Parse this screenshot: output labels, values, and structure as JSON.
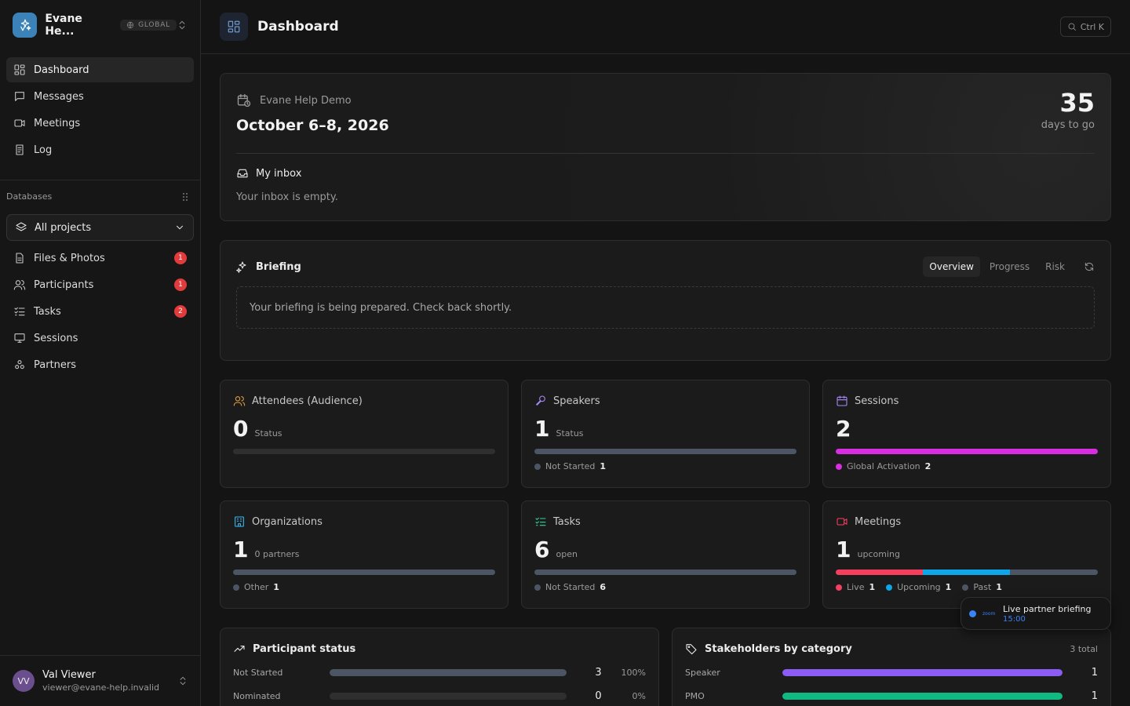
{
  "workspace": {
    "name": "Evane He...",
    "badge": "GLOBAL"
  },
  "nav": [
    {
      "label": "Dashboard",
      "icon": "dashboard-icon",
      "active": true
    },
    {
      "label": "Messages",
      "icon": "message-icon"
    },
    {
      "label": "Meetings",
      "icon": "video-icon"
    },
    {
      "label": "Log",
      "icon": "log-icon"
    }
  ],
  "databases": {
    "heading": "Databases",
    "selector": "All projects",
    "items": [
      {
        "label": "Files & Photos",
        "icon": "file-icon",
        "badge": "1"
      },
      {
        "label": "Participants",
        "icon": "users-icon",
        "badge": "1"
      },
      {
        "label": "Tasks",
        "icon": "list-checks-icon",
        "badge": "2"
      },
      {
        "label": "Sessions",
        "icon": "monitor-icon",
        "badge": ""
      },
      {
        "label": "Partners",
        "icon": "partners-icon",
        "badge": ""
      }
    ]
  },
  "user": {
    "initials": "VV",
    "name": "Val Viewer",
    "email": "viewer@evane-help.invalid"
  },
  "header": {
    "title": "Dashboard",
    "search_shortcut": "Ctrl K"
  },
  "event": {
    "name": "Evane Help Demo",
    "dates": "October 6–8, 2026",
    "countdown": "35",
    "countdown_label": "days to go",
    "inbox_title": "My inbox",
    "inbox_empty": "Your inbox is empty."
  },
  "briefing": {
    "title": "Briefing",
    "tabs": [
      "Overview",
      "Progress",
      "Risk"
    ],
    "active_tab": 0,
    "message": "Your briefing is being prepared. Check back shortly."
  },
  "stats": [
    {
      "title": "Attendees (Audience)",
      "icon": "users-icon",
      "color": "#e0a040",
      "value": "0",
      "sub": "Status",
      "bar": [],
      "legend": []
    },
    {
      "title": "Speakers",
      "icon": "mic-icon",
      "color": "#a78bfa",
      "value": "1",
      "sub": "Status",
      "bar": [
        {
          "color": "#4b5563",
          "fraction": 1
        }
      ],
      "legend": [
        {
          "label": "Not Started",
          "count": "1",
          "color": "#4b5563"
        }
      ]
    },
    {
      "title": "Sessions",
      "icon": "calendar-icon",
      "color": "#a78bfa",
      "value": "2",
      "sub": "",
      "bar": [
        {
          "color": "#d62ee0",
          "fraction": 1
        }
      ],
      "legend": [
        {
          "label": "Global Activation",
          "count": "2",
          "color": "#d62ee0"
        }
      ]
    },
    {
      "title": "Organizations",
      "icon": "building-icon",
      "color": "#38bdf8",
      "value": "1",
      "sub": "0 partners",
      "bar": [
        {
          "color": "#4b5563",
          "fraction": 1
        }
      ],
      "legend": [
        {
          "label": "Other",
          "count": "1",
          "color": "#4b5563"
        }
      ]
    },
    {
      "title": "Tasks",
      "icon": "list-checks-icon",
      "color": "#34d399",
      "value": "6",
      "sub": "open",
      "bar": [
        {
          "color": "#4b5563",
          "fraction": 1
        }
      ],
      "legend": [
        {
          "label": "Not Started",
          "count": "6",
          "color": "#4b5563"
        }
      ]
    },
    {
      "title": "Meetings",
      "icon": "video-icon",
      "color": "#f43f5e",
      "value": "1",
      "sub": "upcoming",
      "bar": [
        {
          "color": "#f43f5e",
          "fraction": 0.333
        },
        {
          "color": "#0ea5e9",
          "fraction": 0.333
        },
        {
          "color": "#4b5563",
          "fraction": 0.334
        }
      ],
      "legend": [
        {
          "label": "Live",
          "count": "1",
          "color": "#f43f5e"
        },
        {
          "label": "Upcoming",
          "count": "1",
          "color": "#0ea5e9"
        },
        {
          "label": "Past",
          "count": "1",
          "color": "#4b5563"
        }
      ]
    }
  ],
  "participant_status": {
    "title": "Participant status",
    "rows": [
      {
        "label": "Not Started",
        "count": "3",
        "pct": "100%",
        "fraction": 1,
        "color": "#4b5563"
      },
      {
        "label": "Nominated",
        "count": "0",
        "pct": "0%",
        "fraction": 0,
        "color": "#4b5563"
      }
    ]
  },
  "stakeholders": {
    "title": "Stakeholders by category",
    "total": "3 total",
    "rows": [
      {
        "label": "Speaker",
        "count": "1",
        "fraction": 1,
        "color": "#8b5cf6"
      },
      {
        "label": "PMO",
        "count": "1",
        "fraction": 1,
        "color": "#10b981"
      }
    ]
  },
  "toast": {
    "provider": "zoom",
    "title": "Live partner briefing",
    "time": "15:00"
  }
}
